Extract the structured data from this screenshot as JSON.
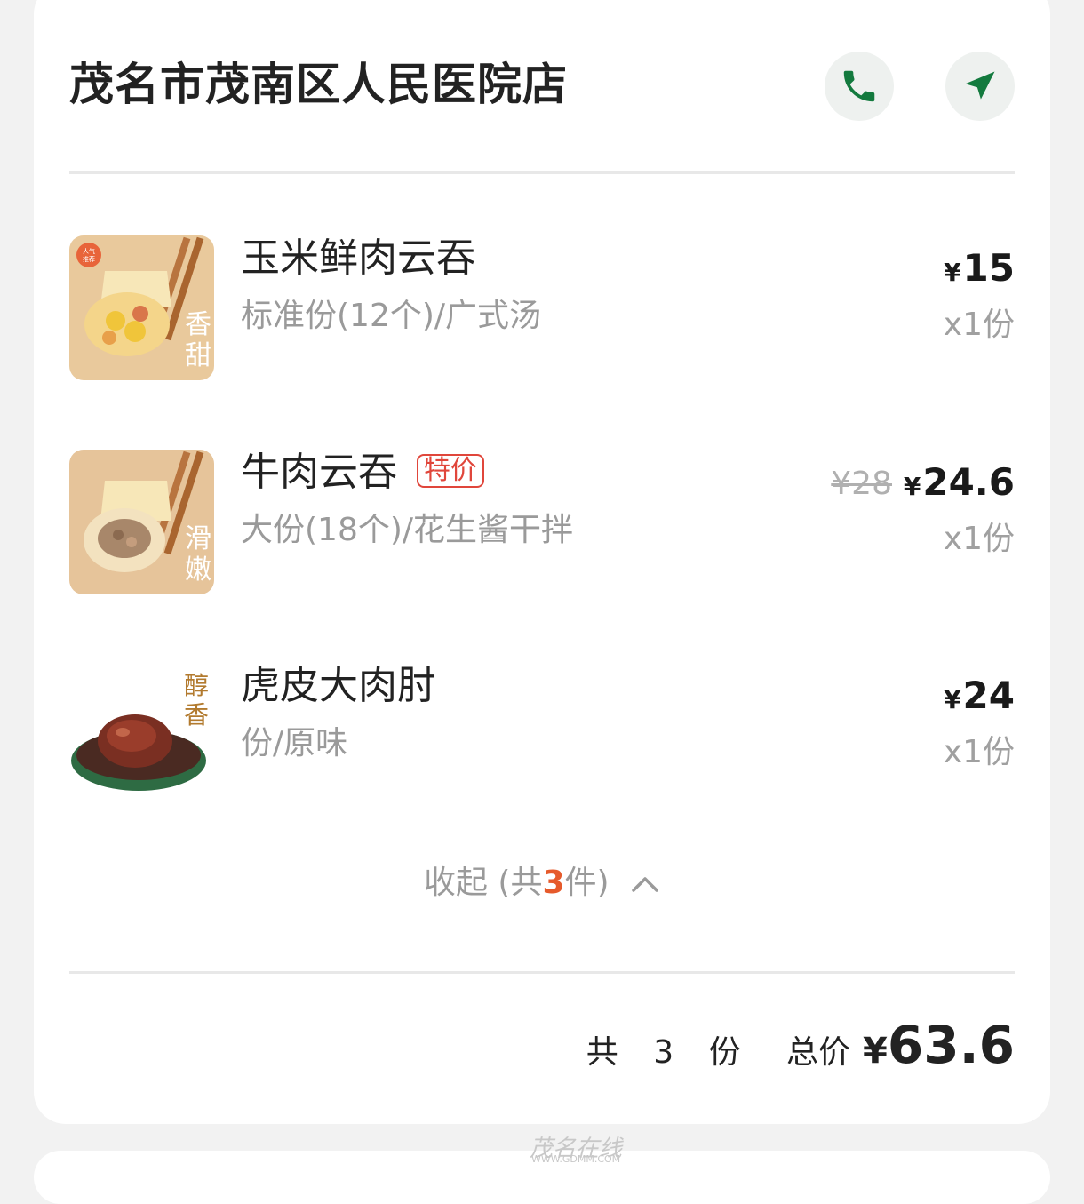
{
  "store": {
    "name": "茂名市茂南区人民医院店",
    "call_icon": "phone-icon",
    "nav_icon": "navigation-arrow-icon"
  },
  "items": [
    {
      "name": "玉米鲜肉云吞",
      "spec": "标准份(12个)/广式汤",
      "currency": "¥",
      "price": "15",
      "qty": "x1份",
      "thumb_text": "香甜",
      "thumb_badge": "人气推荐"
    },
    {
      "name": "牛肉云吞",
      "tag": "特价",
      "spec": "大份(18个)/花生酱干拌",
      "original_price": "¥28",
      "currency": "¥",
      "price": "24.6",
      "qty": "x1份",
      "thumb_text": "滑嫩"
    },
    {
      "name": "虎皮大肉肘",
      "spec": "份/原味",
      "currency": "¥",
      "price": "24",
      "qty": "x1份",
      "thumb_text": "醇香"
    }
  ],
  "collapse": {
    "prefix": "收起 (共",
    "count": "3",
    "suffix": "件)"
  },
  "summary": {
    "count_label": "共 3 份",
    "total_label": "总价",
    "currency": "¥",
    "total": "63.6"
  },
  "watermark": {
    "text": "茂名在线",
    "url": "WWW.GDMM.COM"
  }
}
